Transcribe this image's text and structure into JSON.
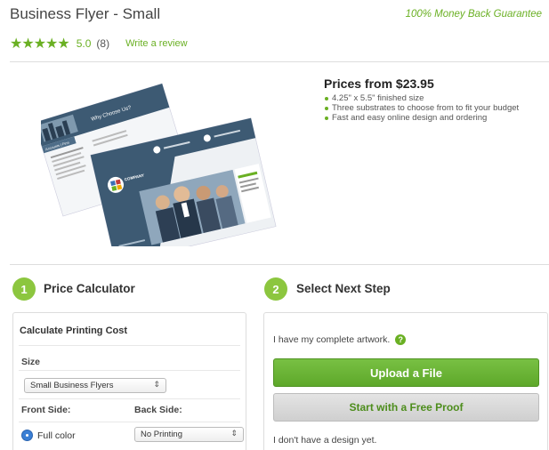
{
  "product": {
    "title": "Business Flyer - Small",
    "guarantee": "100% Money Back Guarantee",
    "stars": "★★★★★",
    "rating": "5.0",
    "review_count": "(8)",
    "review_link": "Write a review"
  },
  "pricing": {
    "title": "Prices from $23.95",
    "bullets": [
      "4.25\" x 5.5\" finished size",
      "Three substrates to choose from to fit your budget",
      "Fast and easy online design and ordering"
    ]
  },
  "flyer_preview": {
    "headline": "Why Choose Us?",
    "company": "COMPANY",
    "banner": "Accounts | Firm"
  },
  "steps": [
    {
      "number": "1",
      "title": "Price Calculator"
    },
    {
      "number": "2",
      "title": "Select Next Step"
    }
  ],
  "calculator": {
    "heading": "Calculate Printing Cost",
    "size_label": "Size",
    "size_value": "Small Business Flyers",
    "front_label": "Front Side:",
    "back_label": "Back Side:",
    "front_option": "Full color",
    "back_value": "No Printing"
  },
  "next_step": {
    "artwork_text": "I have my complete artwork.",
    "upload_label": "Upload a File",
    "proof_label": "Start with a Free Proof",
    "no_design_text": "I don't have a design yet."
  },
  "colors": {
    "brand_green": "#6ab023",
    "badge_green": "#8cc63f",
    "flyer_blue": "#3d5a73"
  },
  "icons": {
    "star": "star-icon",
    "info": "info-icon",
    "select_arrows": "updown-arrow-icon",
    "radio": "radio-selected-icon"
  }
}
